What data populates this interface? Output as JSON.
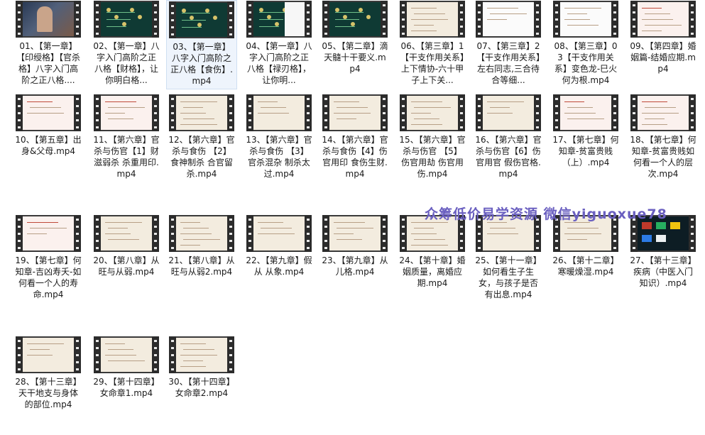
{
  "watermark": "众筹低价易学资源  微信yiguoxue78",
  "files": [
    {
      "label": "01、【第一章】【印绶格】【官杀格】八字入门高阶之正八格....",
      "thumb": "video"
    },
    {
      "label": "02、【第一章】八字入门高阶之正八格【财格】，让你明白格...",
      "thumb": "dark"
    },
    {
      "label": "03、【第一章】八字入门高阶之正八格【食伤】.mp4",
      "thumb": "dark",
      "selected": true
    },
    {
      "label": "04、【第一章】八字入门高阶之正八格【禄刃格】，让你明...",
      "thumb": "dark-white"
    },
    {
      "label": "05、【第二章】滴天髓十干要义.mp4",
      "thumb": "dark"
    },
    {
      "label": "06、【第三章】1【干支作用关系】上下情协-六十甲子上下关...",
      "thumb": "light"
    },
    {
      "label": "07、【第三章】2【干支作用关系】左右同志,三合待合等细...",
      "thumb": "white"
    },
    {
      "label": "08、【第三章】03【干支作用关系】变色龙-巳火何为根.mp4",
      "thumb": "white"
    },
    {
      "label": "09、【第四章】婚姻篇-结婚应期.mp4",
      "thumb": "pink"
    },
    {
      "label": "10、【第五章】出身&父母.mp4",
      "thumb": "pink"
    },
    {
      "label": "11、【第六章】官杀与伤官【1】财滋弱杀 杀重用印.mp4",
      "thumb": "pink"
    },
    {
      "label": "12、【第六章】官杀与食伤 【2】食神制杀 合官留杀.mp4",
      "thumb": "light"
    },
    {
      "label": "13、【第六章】官杀与食伤 【3】官杀混杂 制杀太过.mp4",
      "thumb": "light"
    },
    {
      "label": "14、【第六章】官杀与食伤【4】伤官用印 食伤生财.mp4",
      "thumb": "light"
    },
    {
      "label": "15、【第六章】官杀与伤官 【5】伤官用劫 伤官用伤.mp4",
      "thumb": "light"
    },
    {
      "label": "16、【第六章】官杀与伤官【6】伤官用官 假伤官格.mp4",
      "thumb": "light"
    },
    {
      "label": "17、【第七章】何知章-贫富贵贱（上）.mp4",
      "thumb": "pink"
    },
    {
      "label": "18、【第七章】何知章-贫富贵贱如何看一个人的层次.mp4",
      "thumb": "pink"
    },
    {
      "label": "19、【第七章】何知章-吉凶寿夭-如何看一个人的寿命.mp4",
      "thumb": "pink"
    },
    {
      "label": "20、【第八章】从旺与从弱.mp4",
      "thumb": "light"
    },
    {
      "label": "21、【第八章】从旺与从弱2.mp4",
      "thumb": "light"
    },
    {
      "label": "22、【第九章】假从 从象.mp4",
      "thumb": "light"
    },
    {
      "label": "23、【第九章】从儿格.mp4",
      "thumb": "light"
    },
    {
      "label": "24、【第十章】婚姻质量，离婚应期.mp4",
      "thumb": "light"
    },
    {
      "label": "25、【第十一章】如何看生子生女，与孩子是否有出息.mp4",
      "thumb": "light"
    },
    {
      "label": "26、【第十二章】寒暖燥湿.mp4",
      "thumb": "light"
    },
    {
      "label": "27、【第十三章】疾病（中医入门知识）.mp4",
      "thumb": "panel"
    },
    {
      "label": "28、【第十三章】天干地支与身体的部位.mp4",
      "thumb": "light"
    },
    {
      "label": "29、【第十四章】女命章1.mp4",
      "thumb": "light"
    },
    {
      "label": "30、【第十四章】女命章2.mp4",
      "thumb": "light"
    }
  ]
}
